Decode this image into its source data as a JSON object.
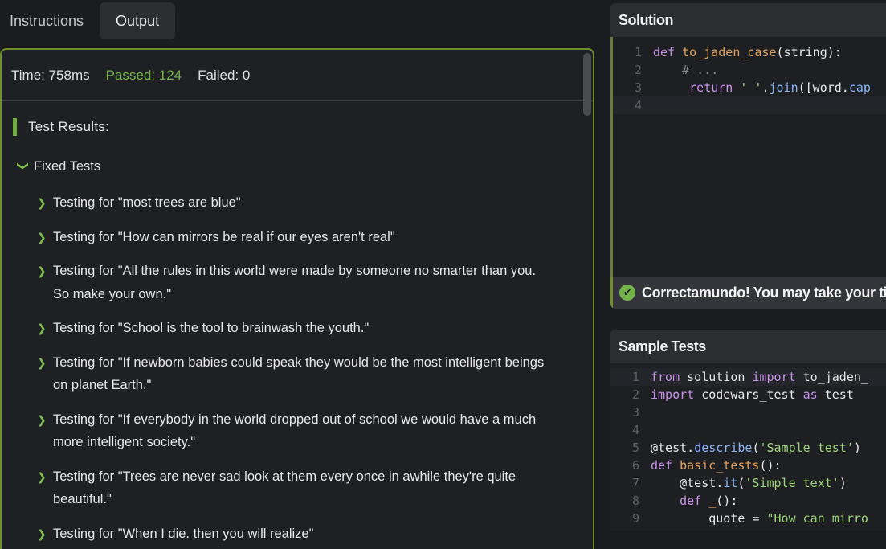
{
  "tabs": [
    {
      "label": "Instructions"
    },
    {
      "label": "Output"
    }
  ],
  "output": {
    "time": "Time: 758ms",
    "passed": "Passed: 124",
    "failed": "Failed: 0",
    "results_title": "Test Results:",
    "group_title": "Fixed Tests",
    "tests": [
      "Testing for \"most trees are blue\"",
      "Testing for \"How can mirrors be real if our eyes aren't real\"",
      "Testing for \"All the rules in this world were made by someone no smarter than you. So make your own.\"",
      "Testing for \"School is the tool to brainwash the youth.\"",
      "Testing for \"If newborn babies could speak they would be the most intelligent beings on planet Earth.\"",
      "Testing for \"If everybody in the world dropped out of school we would have a much more intelligent society.\"",
      "Testing for \"Trees are never sad look at them every once in awhile they're quite beautiful.\"",
      "Testing for \"When I die. then you will realize\""
    ]
  },
  "solution": {
    "title": "Solution",
    "lines": [
      "1",
      "2",
      "3",
      "4"
    ],
    "success_message": "Correctamundo! You may take your ti"
  },
  "sample_tests": {
    "title": "Sample Tests",
    "lines": [
      "1",
      "2",
      "3",
      "4",
      "5",
      "6",
      "7",
      "8",
      "9"
    ]
  },
  "colors": {
    "accent_green": "#6f8f2c",
    "passed_green": "#74b34a",
    "background": "#1b1c20"
  },
  "icons": [
    "chevron-right-icon",
    "chevron-down-icon",
    "check-circle-icon"
  ]
}
